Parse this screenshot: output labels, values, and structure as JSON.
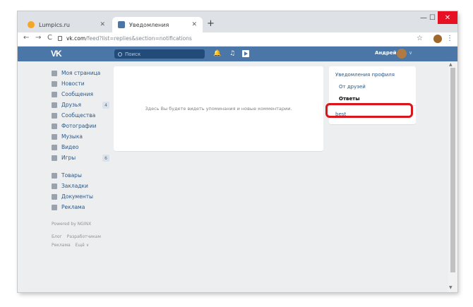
{
  "browser": {
    "tabs": [
      {
        "label": "Lumpics.ru",
        "close": "✕"
      },
      {
        "label": "Уведомления",
        "close": "✕"
      }
    ],
    "new_tab": "+",
    "window_controls": {
      "minimize": "—",
      "maximize": "☐",
      "close": "✕"
    },
    "url_host": "vk.com",
    "url_path": "/feed?list=replies&section=notifications",
    "nav": {
      "back": "←",
      "forward": "→",
      "reload": "C"
    },
    "star": "☆",
    "menu": "⋮"
  },
  "vk_header": {
    "logo": "VK",
    "search_placeholder": "Поиск",
    "user_name": "Андрей",
    "user_drop": "∨",
    "bell": "🔔",
    "music": "♫"
  },
  "sidebar": {
    "items": [
      {
        "label": "Моя страница",
        "icon": "home-icon"
      },
      {
        "label": "Новости",
        "icon": "news-icon"
      },
      {
        "label": "Сообщения",
        "icon": "messages-icon"
      },
      {
        "label": "Друзья",
        "icon": "friends-icon",
        "badge": "4"
      },
      {
        "label": "Сообщества",
        "icon": "groups-icon"
      },
      {
        "label": "Фотографии",
        "icon": "camera-icon"
      },
      {
        "label": "Музыка",
        "icon": "music-icon"
      },
      {
        "label": "Видео",
        "icon": "video-icon"
      },
      {
        "label": "Игры",
        "icon": "games-icon",
        "badge": "6"
      }
    ],
    "items2": [
      {
        "label": "Товары",
        "icon": "bag-icon"
      },
      {
        "label": "Закладки",
        "icon": "star-icon"
      },
      {
        "label": "Документы",
        "icon": "document-icon"
      },
      {
        "label": "Реклама",
        "icon": "megaphone-icon"
      }
    ],
    "powered": "Powered by NGINX",
    "footer_links_1": [
      "Блог",
      "Разработчикам"
    ],
    "footer_links_2": [
      "Реклама",
      "Ещё ∨"
    ]
  },
  "main": {
    "empty_text": "Здесь Вы будете видеть упоминания и новые комментарии."
  },
  "right_panel": {
    "header": "Уведомления профиля",
    "items": [
      "От друзей",
      "Ответы"
    ],
    "selected": "Ответы",
    "extra": "best"
  },
  "colors": {
    "vk_blue": "#4a76a8",
    "highlight_red": "#d9161c"
  }
}
